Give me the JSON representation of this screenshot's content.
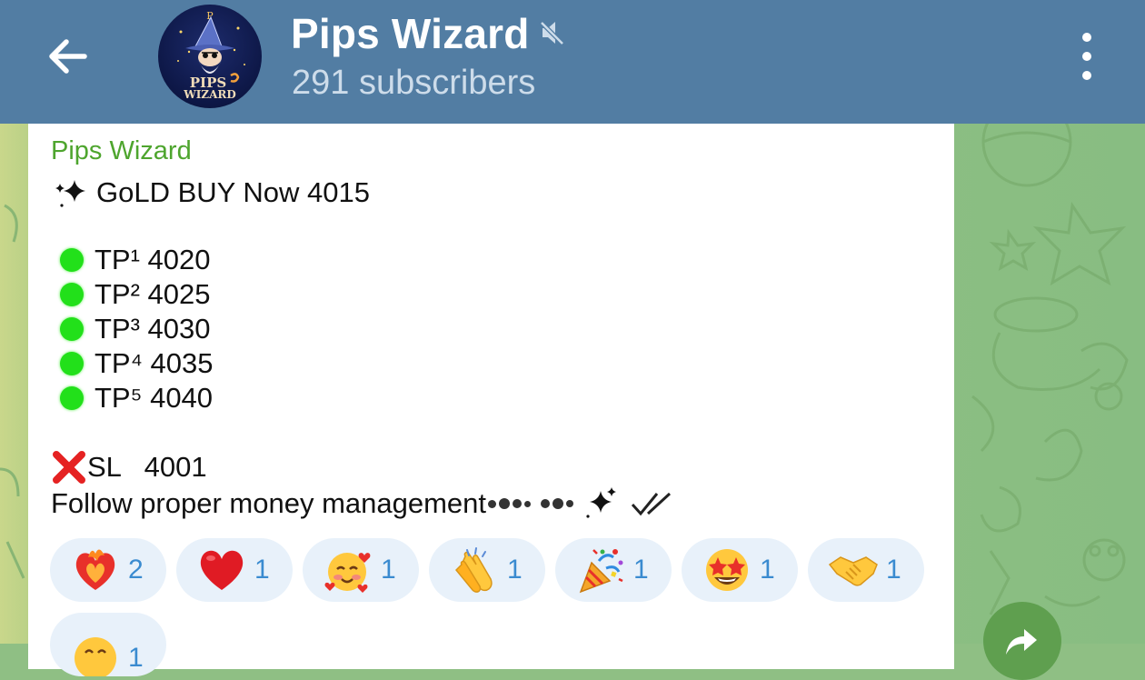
{
  "header": {
    "title": "Pips Wizard",
    "subtitle": "291 subscribers",
    "avatar_text_line1": "PIPS",
    "avatar_text_line2": "WIZARD",
    "avatar_text_top": "P",
    "icons": {
      "back": "arrow-left-icon",
      "mute": "muted-speaker-icon",
      "menu": "more-vertical-icon"
    },
    "colors": {
      "bar": "#527da3",
      "subtitle": "#cddcea"
    }
  },
  "message": {
    "author": "Pips Wizard",
    "headline": "GoLD BUY Now 4015",
    "targets": [
      {
        "label": "TP¹ 4020"
      },
      {
        "label": "TP² 4025"
      },
      {
        "label": "TP³ 4030"
      },
      {
        "label": "TP⁴ 4035"
      },
      {
        "label": "TP⁵ 4040"
      }
    ],
    "stop_loss": "SL   4001",
    "footer": "Follow proper money management",
    "colors": {
      "author": "#4ea52e",
      "target_dot": "#22e01a",
      "cross": "#e52222"
    }
  },
  "reactions": [
    {
      "emoji": "heart-on-fire",
      "count": "2"
    },
    {
      "emoji": "red-heart",
      "count": "1"
    },
    {
      "emoji": "smiling-face-with-hearts",
      "count": "1"
    },
    {
      "emoji": "clapping-hands",
      "count": "1"
    },
    {
      "emoji": "party-popper",
      "count": "1"
    },
    {
      "emoji": "star-struck",
      "count": "1"
    },
    {
      "emoji": "handshake",
      "count": "1"
    },
    {
      "emoji": "grinning-face",
      "count": "1"
    }
  ],
  "colors": {
    "reaction_bg": "#e8f1fa",
    "reaction_count": "#3a8bd0"
  }
}
